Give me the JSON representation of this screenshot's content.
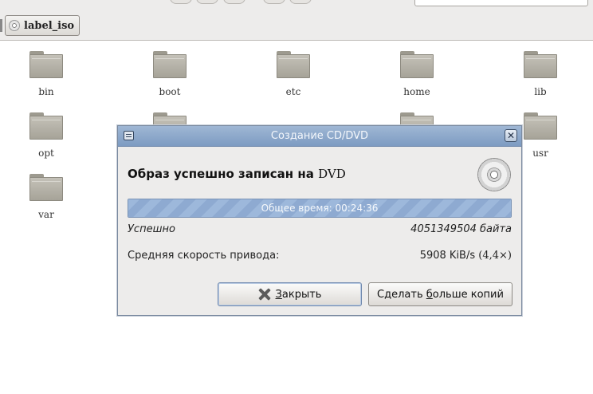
{
  "location": {
    "path_button_label": "label_iso"
  },
  "folders": [
    {
      "name": "bin"
    },
    {
      "name": "boot"
    },
    {
      "name": "etc"
    },
    {
      "name": "home"
    },
    {
      "name": "lib"
    },
    {
      "name": "opt"
    },
    {
      "name": "usr"
    },
    {
      "name": "var"
    }
  ],
  "dialog": {
    "title": "Создание CD/DVD",
    "heading_text": "Образ успешно записан на",
    "heading_media": "DVD",
    "progress": {
      "text": "Общее время: 00:24:36",
      "fraction": 1.0
    },
    "status": "Успешно",
    "bytes_written": "4051349504 байта",
    "speed_label": "Средняя скорость привода:",
    "speed_value": "5908 KiB/s",
    "speed_ratio": "(4,4×)",
    "buttons": {
      "close_label_mnemonic": "З",
      "close_label_rest": "акрыть",
      "copies_label_before": "Сделать ",
      "copies_label_mnemonic": "б",
      "copies_label_after": "ольше копий"
    }
  },
  "colors": {
    "titlebar": "#8ea9cc",
    "progress_fill": "#9db8db",
    "folder": "#b5b2a8"
  },
  "icons": {
    "disc": "cd-dvd-icon",
    "close": "close-icon",
    "menu": "window-menu-icon",
    "folder": "folder-icon"
  }
}
